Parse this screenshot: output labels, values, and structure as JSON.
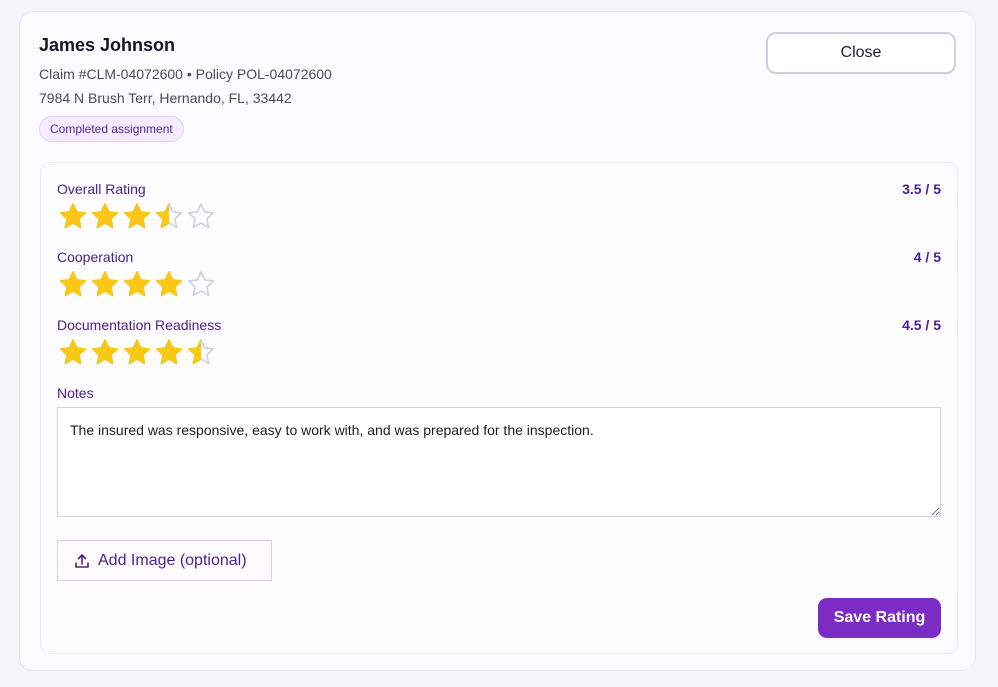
{
  "header": {
    "name": "James Johnson",
    "claim_line": "Claim #CLM-04072600 • Policy POL-04072600",
    "address": "7984 N Brush Terr, Hernando, FL, 33442",
    "status_badge": "Completed assignment",
    "close_label": "Close"
  },
  "ratings": [
    {
      "label": "Overall Rating",
      "score_text": "3.5 / 5",
      "value": 3.5
    },
    {
      "label": "Cooperation",
      "score_text": "4 / 5",
      "value": 4
    },
    {
      "label": "Documentation Readiness",
      "score_text": "4.5 / 5",
      "value": 4.5
    }
  ],
  "notes": {
    "label": "Notes",
    "value": "The insured was responsive, easy to work with, and was prepared for the inspection."
  },
  "upload": {
    "label": "Add Image (optional)",
    "icon": "upload-icon"
  },
  "actions": {
    "save_label": "Save Rating"
  },
  "colors": {
    "accent": "#7b2cc4",
    "label_purple": "#4b1f8f",
    "star_filled": "#f9c817",
    "star_empty_stroke": "#d0d0d8"
  }
}
